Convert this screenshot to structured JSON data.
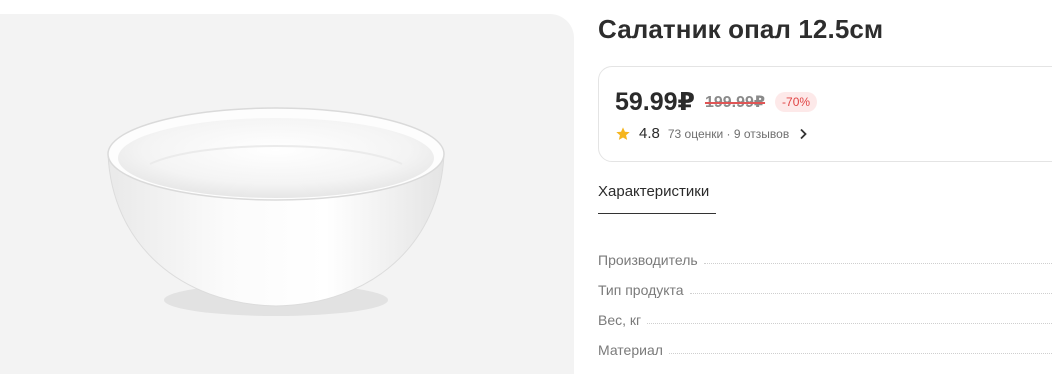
{
  "product": {
    "title": "Салатник опал 12.5см",
    "image_alt": "white opal bowl"
  },
  "price": {
    "current": "59.99₽",
    "old": "199.99₽",
    "discount": "-70%"
  },
  "rating": {
    "icon": "star-icon",
    "value": "4.8",
    "meta": "73 оценки · 9 отзывов"
  },
  "tabs": {
    "characteristics": "Характеристики"
  },
  "specs": [
    {
      "label": "Производитель"
    },
    {
      "label": "Тип продукта"
    },
    {
      "label": "Вес, кг"
    },
    {
      "label": "Материал"
    }
  ],
  "colors": {
    "gallery_bg": "#f3f3f3",
    "discount_text": "#e04444",
    "discount_bg": "#fde9e9",
    "star": "#f5b51e"
  }
}
